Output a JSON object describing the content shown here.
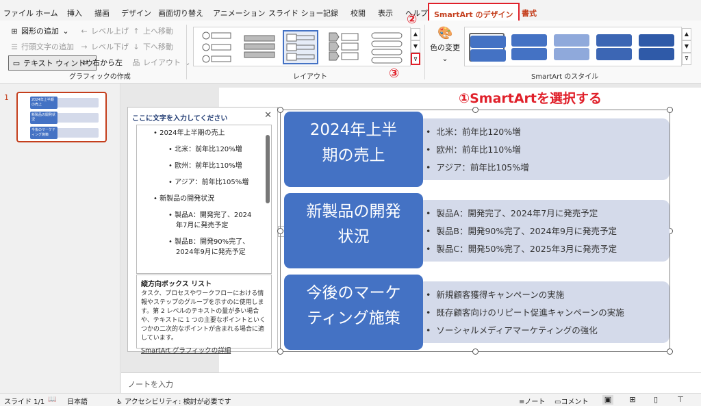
{
  "menu": {
    "file": "ファイル",
    "home": "ホーム",
    "insert": "挿入",
    "draw": "描画",
    "design": "デザイン",
    "transitions": "画面切り替え",
    "animations": "アニメーション",
    "slideshow": "スライド ショー",
    "record": "記録",
    "review": "校閲",
    "view": "表示",
    "help": "ヘルプ",
    "smartart_design": "SmartArt のデザイン",
    "format": "書式"
  },
  "ribbon": {
    "add_shape": "図形の追加",
    "level_up": "レベル上げ",
    "move_up": "上へ移動",
    "add_bullet": "行頭文字の追加",
    "level_down": "レベル下げ",
    "move_down": "下へ移動",
    "text_pane": "テキスト ウィンドウ",
    "rtl": "右から左",
    "layout_btn": "レイアウト",
    "group_create": "グラフィックの作成",
    "group_layout": "レイアウト",
    "change_colors": "色の変更",
    "group_styles": "SmartArt のスタイル"
  },
  "callouts": {
    "one": "①",
    "two": "②",
    "three": "③",
    "headline": "①SmartArtを選択する"
  },
  "thumbnail": {
    "slide_number": "1",
    "box1": "2024年上半期の売上",
    "box2": "新製品の開発状況",
    "box3": "今後のマーケティング施策"
  },
  "text_pane": {
    "title": "ここに文字を入力してください",
    "close": "✕",
    "items": [
      {
        "text": "2024年上半期の売上",
        "level": 1
      },
      {
        "text": "北米：前年比120%増",
        "level": 2
      },
      {
        "text": "欧州：前年比110%増",
        "level": 2
      },
      {
        "text": "アジア：前年比105%増",
        "level": 2
      },
      {
        "text": "新製品の開発状況",
        "level": 1
      },
      {
        "text": "製品A：開発完了、2024",
        "level": 2
      },
      {
        "text": "年7月に発売予定",
        "level": 3
      },
      {
        "text": "製品B：開発90%完了、",
        "level": 2
      },
      {
        "text": "2024年9月に発売予定",
        "level": 3
      }
    ],
    "desc_title": "縦方向ボックス リスト",
    "desc_body": "タスク、プロセスやワークフローにおける情報やステップのグループを示すのに使用します。第 2 レベルのテキストの量が多い場合や、テキストに 1 つの主要なポイントといくつかの二次的なポイントが含まれる場合に適しています。",
    "desc_link": "SmartArt グラフィックの詳細"
  },
  "smartart": {
    "blocks": [
      {
        "title_l1": "2024年上半",
        "title_l2": "期の売上",
        "bullets": [
          "北米：前年比120%増",
          "欧州：前年比110%増",
          "アジア：前年比105%増"
        ]
      },
      {
        "title_l1": "新製品の開発",
        "title_l2": "状況",
        "bullets": [
          "製品A：開発完了、2024年7月に発売予定",
          "製品B：開発90%完了、2024年9月に発売予定",
          "製品C：開発50%完了、2025年3月に発売予定"
        ]
      },
      {
        "title_l1": "今後のマーケ",
        "title_l2": "ティング施策",
        "bullets": [
          "新規顧客獲得キャンペーンの実施",
          "既存顧客向けのリピート促進キャンペーンの実施",
          "ソーシャルメディアマーケティングの強化"
        ]
      }
    ]
  },
  "notes": {
    "placeholder": "ノートを入力"
  },
  "status": {
    "slide": "スライド 1/1",
    "language": "日本語",
    "accessibility": "アクセシビリティ: 検討が必要です",
    "notes_btn": "ノート",
    "comments_btn": "コメント"
  },
  "colors": {
    "accent": "#4472c4",
    "light_bar": "#d4daea",
    "highlight": "#e0202a",
    "tab": "#c43e1c"
  }
}
